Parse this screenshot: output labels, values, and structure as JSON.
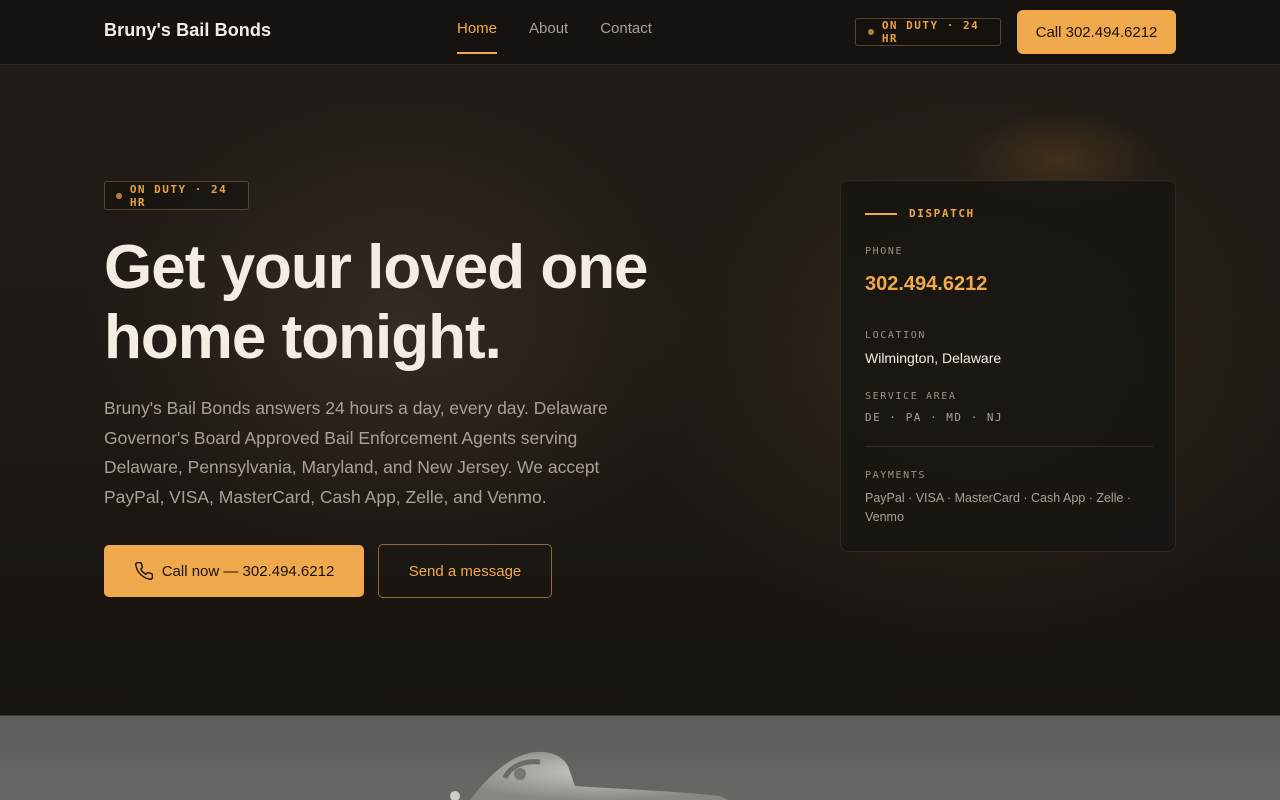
{
  "nav": {
    "brand": "Bruny's Bail Bonds",
    "links": [
      {
        "label": "Home",
        "active": true
      },
      {
        "label": "About",
        "active": false
      },
      {
        "label": "Contact",
        "active": false
      }
    ],
    "status_badge": "ON DUTY · 24 HR",
    "call_button": "Call 302.494.6212"
  },
  "hero": {
    "status_badge": "ON DUTY · 24 HR",
    "headline_line1": "Get your loved one",
    "headline_line2": "home tonight.",
    "lede": "Bruny's Bail Bonds answers 24 hours a day, every day. Delaware Governor's Board Approved Bail Enforcement Agents serving Delaware, Pennsylvania, Maryland, and New Jersey. We accept PayPal, VISA, MasterCard, Cash App, Zelle, and Venmo.",
    "primary_button": "Call now — 302.494.6212",
    "secondary_button": "Send a message"
  },
  "dispatch": {
    "title": "DISPATCH",
    "phone_label": "PHONE",
    "phone": "302.494.6212",
    "location_label": "LOCATION",
    "location": "Wilmington, Delaware",
    "service_area_label": "SERVICE AREA",
    "service_area": "DE · PA · MD · NJ",
    "payments_label": "PAYMENTS",
    "payments": "PayPal · VISA · MasterCard · Cash App · Zelle · Venmo"
  },
  "icons": {
    "status_dot": "status-dot-icon",
    "phone": "phone-icon",
    "handcuffs": "handcuffs-image"
  },
  "colors": {
    "accent": "#f0a94c",
    "background": "#1a1714",
    "text": "#f3ede4",
    "muted": "#a9a196"
  }
}
